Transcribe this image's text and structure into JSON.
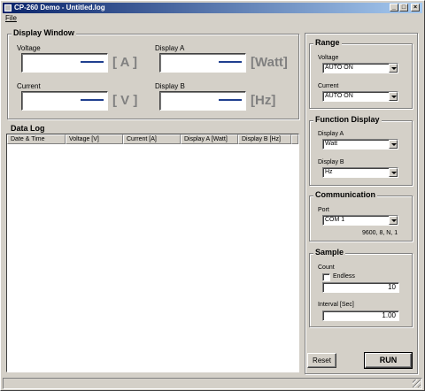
{
  "window": {
    "title": "CP-260 Demo - Untitled.log",
    "minimize_glyph": "_",
    "maximize_glyph": "□",
    "close_glyph": "×"
  },
  "menu": {
    "file": "File"
  },
  "display_window": {
    "title": "Display Window",
    "voltage": {
      "label": "Voltage",
      "unit": "[ A ]"
    },
    "current": {
      "label": "Current",
      "unit": "[ V ]"
    },
    "display_a": {
      "label": "Display A",
      "unit": "[Watt]"
    },
    "display_b": {
      "label": "Display B",
      "unit": "[Hz]"
    }
  },
  "data_log": {
    "title": "Data Log",
    "columns": [
      "Date & Time",
      "Voltage [V]",
      "Current [A]",
      "Display A [Watt]",
      "Display B [Hz]"
    ],
    "rows": []
  },
  "range": {
    "title": "Range",
    "voltage_label": "Voltage",
    "voltage_value": "AUTO ON",
    "current_label": "Current",
    "current_value": "AUTO ON"
  },
  "function_display": {
    "title": "Function Display",
    "display_a_label": "Display A",
    "display_a_value": "Watt",
    "display_b_label": "Display B",
    "display_b_value": "Hz"
  },
  "communication": {
    "title": "Communication",
    "port_label": "Port",
    "port_value": "COM 1",
    "settings": "9600, 8, N, 1"
  },
  "sample": {
    "title": "Sample",
    "count_label": "Count",
    "endless_label": "Endless",
    "endless_checked": false,
    "count_value": "10",
    "interval_label": "Interval  [Sec]",
    "interval_value": "1.00"
  },
  "buttons": {
    "reset": "Reset",
    "run": "RUN"
  }
}
